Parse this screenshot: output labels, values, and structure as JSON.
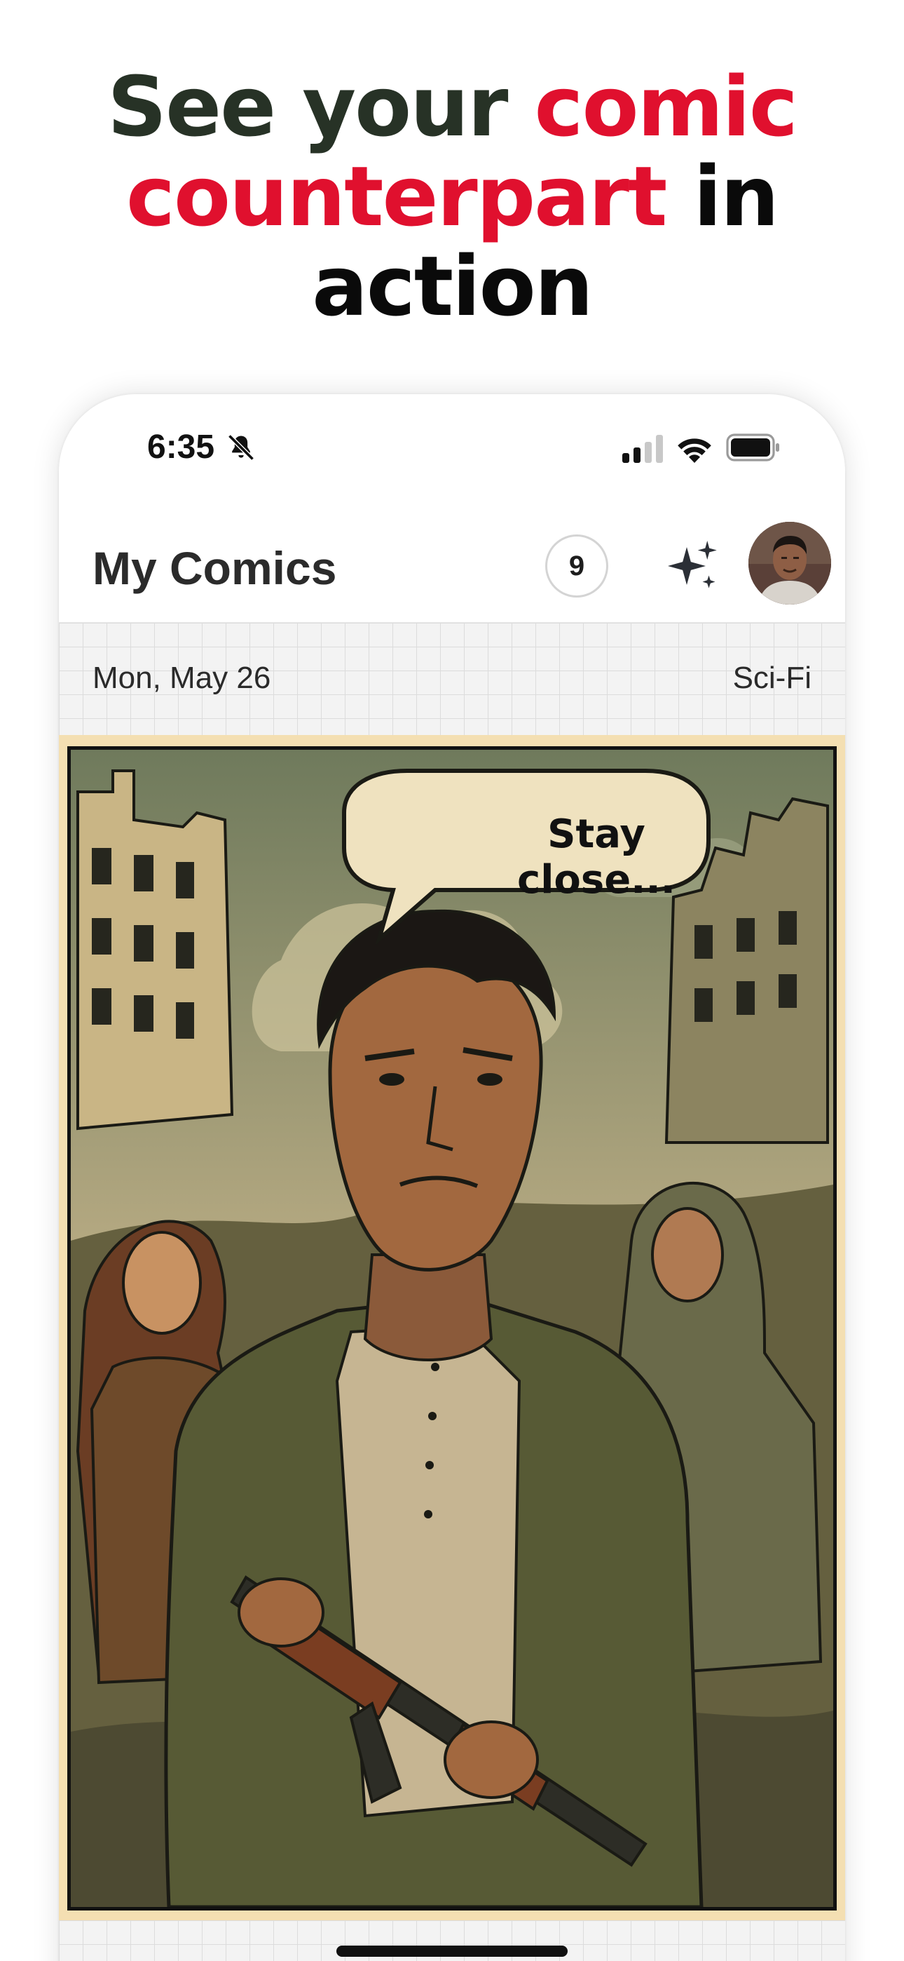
{
  "headline": {
    "part1": "See your ",
    "part2": "comic",
    "part3": "counterpart",
    "part4": " in",
    "part5": "action"
  },
  "status_bar": {
    "time": "6:35",
    "icons": [
      "bell-slash-icon",
      "signal-icon",
      "wifi-icon",
      "battery-icon"
    ]
  },
  "app": {
    "title": "My Comics",
    "count_badge": "9",
    "sparkle_icon": "sparkle-icon",
    "avatar_icon": "user-avatar"
  },
  "comic": {
    "date": "Mon, May 26",
    "genre": "Sci-Fi",
    "speech_bubble": "Stay close..."
  },
  "colors": {
    "headline_dark": "#273226",
    "headline_red": "#e0102e",
    "panel_border": "#f4dfb2"
  }
}
